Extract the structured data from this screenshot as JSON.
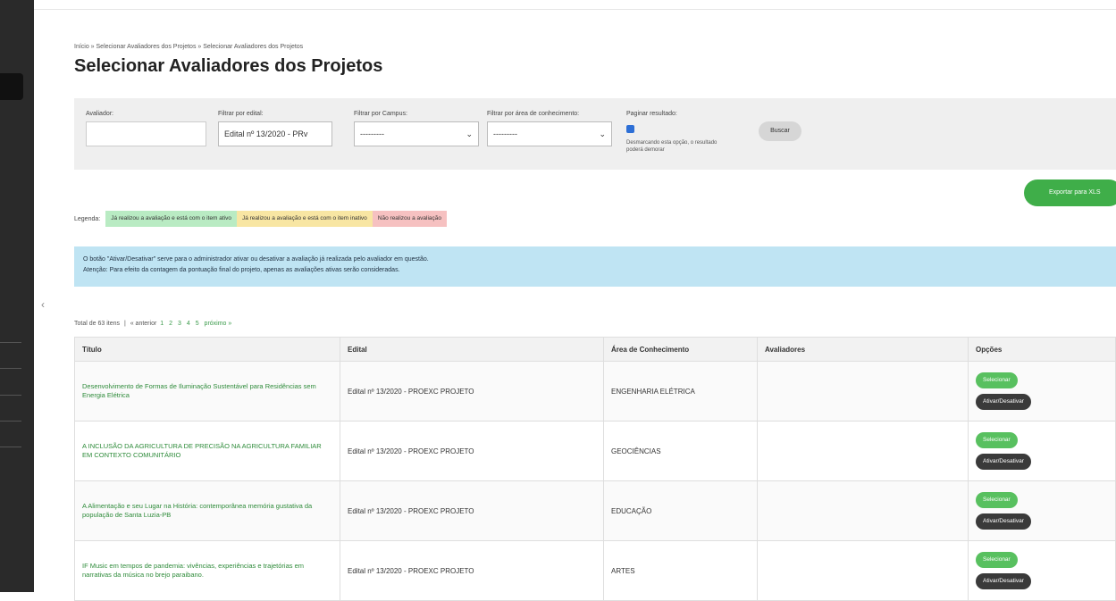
{
  "breadcrumb": "Início » Selecionar Avaliadores dos Projetos » Selecionar Avaliadores dos Projetos",
  "page_title": "Selecionar Avaliadores dos Projetos",
  "filters": {
    "avaliador_label": "Avaliador:",
    "avaliador_value": "",
    "edital_label": "Filtrar por edital:",
    "edital_value": "Edital nº 13/2020 - PRv",
    "campus_label": "Filtrar por Campus:",
    "campus_value": "---------",
    "area_label": "Filtrar por área de conhecimento:",
    "area_value": "---------",
    "paginar_label": "Paginar resultado:",
    "paginar_note": "Desmarcando esta opção, o resultado poderá demorar",
    "buscar": "Buscar"
  },
  "export_button": "Exportar para XLS",
  "legend": {
    "label": "Legenda:",
    "green": "Já realizou a avaliação e está com o item ativo",
    "yellow": "Já realizou a avaliação e está com o item inativo",
    "red": "Não realizou a avaliação"
  },
  "info": {
    "line1": "O botão \"Ativar/Desativar\" serve para o administrador ativar ou desativar a avaliação já realizada pelo avaliador em questão.",
    "line2": "Atenção: Para efeito da contagem da pontuação final do projeto, apenas as avaliações ativas serão consideradas."
  },
  "pagination": {
    "summary": "Total de 63 itens",
    "sep": "|",
    "prev": "« anterior",
    "pages": [
      "1",
      "2",
      "3",
      "4",
      "5"
    ],
    "next": "próximo »"
  },
  "table": {
    "headers": [
      "Título",
      "Edital",
      "Área de Conhecimento",
      "Avaliadores",
      "Opções"
    ],
    "rows": [
      {
        "titulo": "Desenvolvimento de Formas de Iluminação Sustentável para Residências sem Energia Elétrica",
        "edital": "Edital nº 13/2020 - PROEXC PROJETO",
        "area": "ENGENHARIA ELÉTRICA",
        "avaliadores": ""
      },
      {
        "titulo": "A INCLUSÃO DA AGRICULTURA DE PRECISÃO NA AGRICULTURA FAMILIAR EM CONTEXTO COMUNITÁRIO",
        "edital": "Edital nº 13/2020 - PROEXC PROJETO",
        "area": "GEOCIÊNCIAS",
        "avaliadores": ""
      },
      {
        "titulo": "A Alimentação e seu Lugar na História: contemporânea memória gustativa da população de Santa Luzia-PB",
        "edital": "Edital nº 13/2020 - PROEXC PROJETO",
        "area": "EDUCAÇÃO",
        "avaliadores": ""
      },
      {
        "titulo": "IF Music em tempos de pandemia: vivências, experiências e trajetórias em narrativas da música no brejo paraibano.",
        "edital": "Edital nº 13/2020 - PROEXC PROJETO",
        "area": "ARTES",
        "avaliadores": ""
      }
    ],
    "select_label": "Selecionar",
    "toggle_label": "Ativar/Desativar"
  },
  "colors": {
    "accent_green": "#3fae49",
    "link_green": "#2e8b3a",
    "info_blue": "#bfe4f3",
    "sidebar": "#2a2a2a"
  }
}
